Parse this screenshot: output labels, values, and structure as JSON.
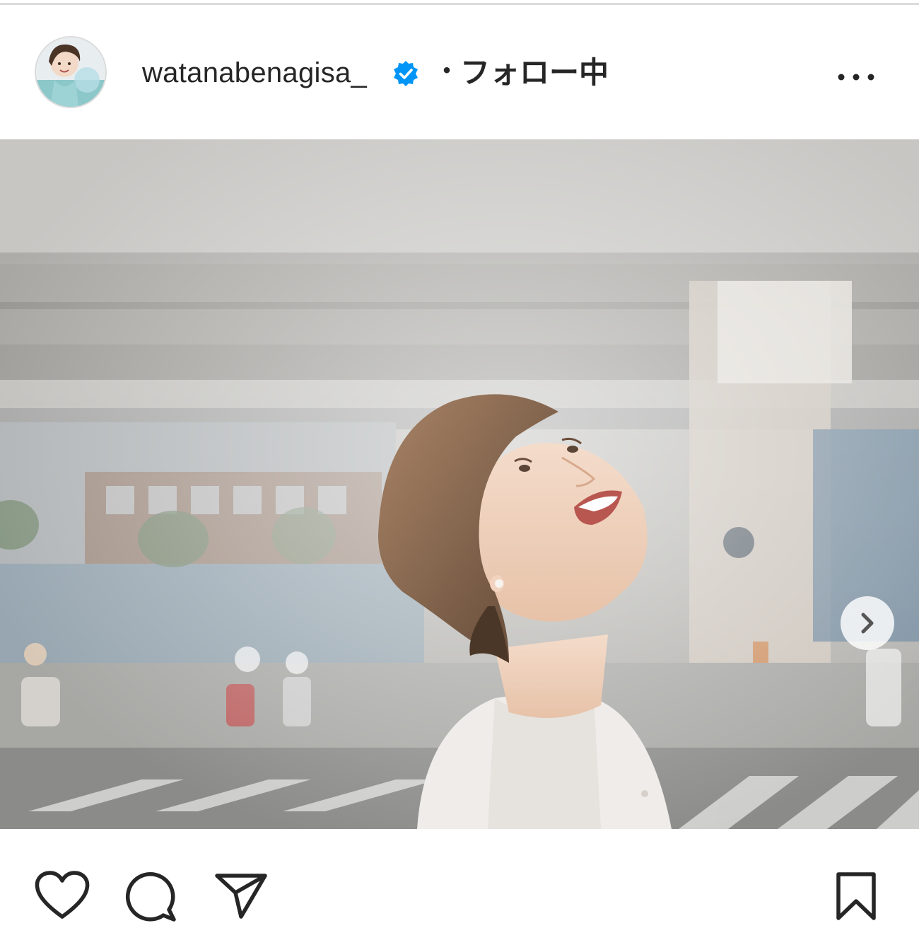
{
  "post": {
    "username": "watanabenagisa_",
    "verified": true,
    "separator": "・",
    "follow_status": "フォロー中",
    "more_icon": "more-horizontal-icon"
  },
  "carousel": {
    "slide_count": 2,
    "active_index": 0,
    "next_icon": "chevron-right-icon"
  },
  "actions": {
    "like_icon": "heart-outline-icon",
    "comment_icon": "comment-bubble-icon",
    "share_icon": "paper-plane-icon",
    "save_icon": "bookmark-outline-icon"
  },
  "colors": {
    "text": "#262626",
    "verified_badge": "#0095f6",
    "divider": "#dbdbdb"
  }
}
